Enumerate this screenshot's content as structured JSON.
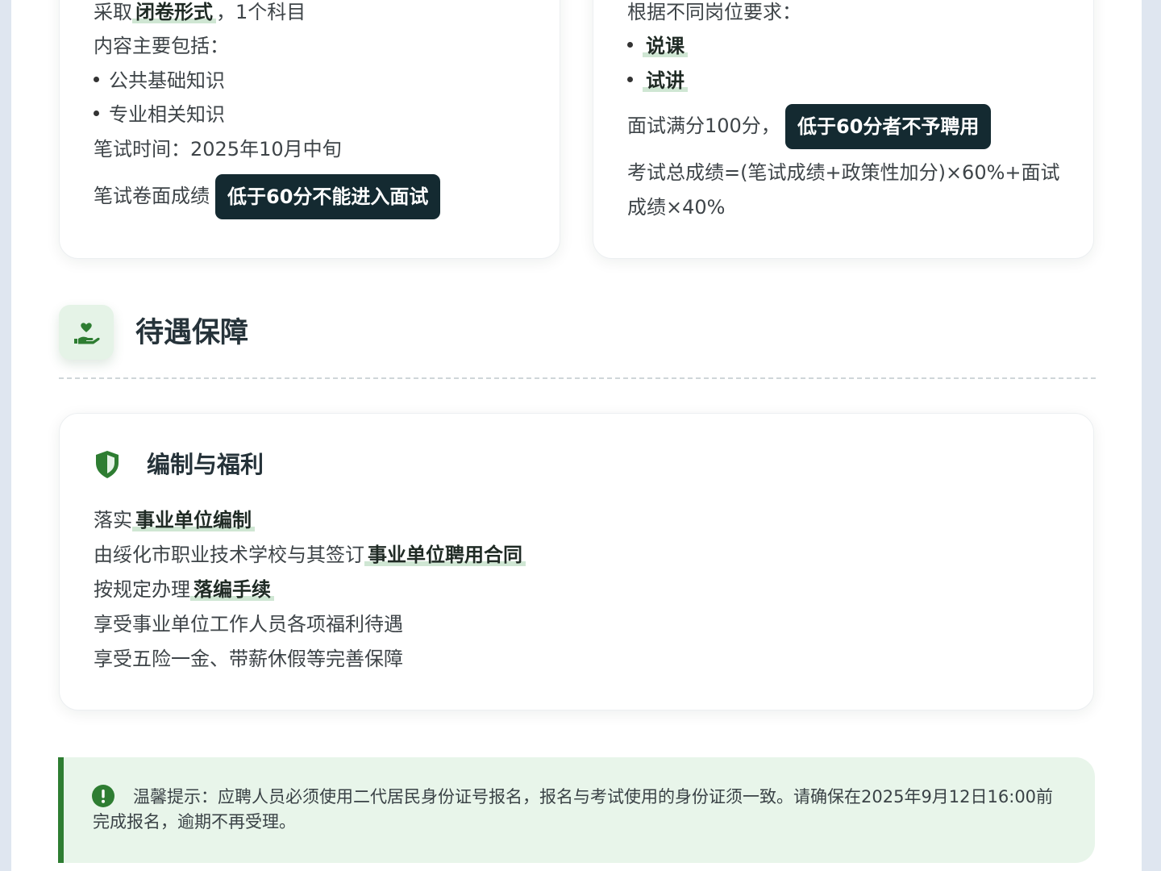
{
  "written_exam": {
    "line1_prefix": "采取",
    "line1_highlight": "闭卷形式",
    "line1_suffix": "，1个科目",
    "content_label": "内容主要包括：",
    "items": [
      "公共基础知识",
      "专业相关知识"
    ],
    "time": "笔试时间：2025年10月中旬",
    "score_prefix": "笔试卷面成绩",
    "score_pill": "低于60分不能进入面试"
  },
  "interview": {
    "requirement_label": "根据不同岗位要求：",
    "items": [
      "说课",
      "试讲"
    ],
    "score_prefix": "面试满分100分，",
    "score_pill": "低于60分者不予聘用",
    "formula_line1": "考试总成绩=(笔试成绩+政策性加分)×60%+面试",
    "formula_line2": "成绩×40%"
  },
  "benefits_section": {
    "title": "待遇保障",
    "icon": "hand-heart-icon"
  },
  "benefits_card": {
    "icon": "shield-icon",
    "title": "编制与福利",
    "line1_prefix": "落实",
    "line1_highlight": "事业单位编制",
    "line2_prefix": "由绥化市职业技术学校与其签订",
    "line2_highlight": "事业单位聘用合同",
    "line3_prefix": "按规定办理",
    "line3_highlight": "落编手续",
    "line4": "享受事业单位工作人员各项福利待遇",
    "line5": "享受五险一金、带薪休假等完善保障"
  },
  "notice": {
    "icon": "exclamation-circle-icon",
    "text": "温馨提示：应聘人员必须使用二代居民身份证号报名，报名与考试使用的身份证须一致。请确保在2025年9月12日16:00前完成报名，逾期不再受理。"
  },
  "colors": {
    "accent_green": "#2e7d32",
    "highlight_green": "#cfe6d3",
    "pill_dark": "#142a31",
    "notice_bg": "#e8f5ea"
  }
}
